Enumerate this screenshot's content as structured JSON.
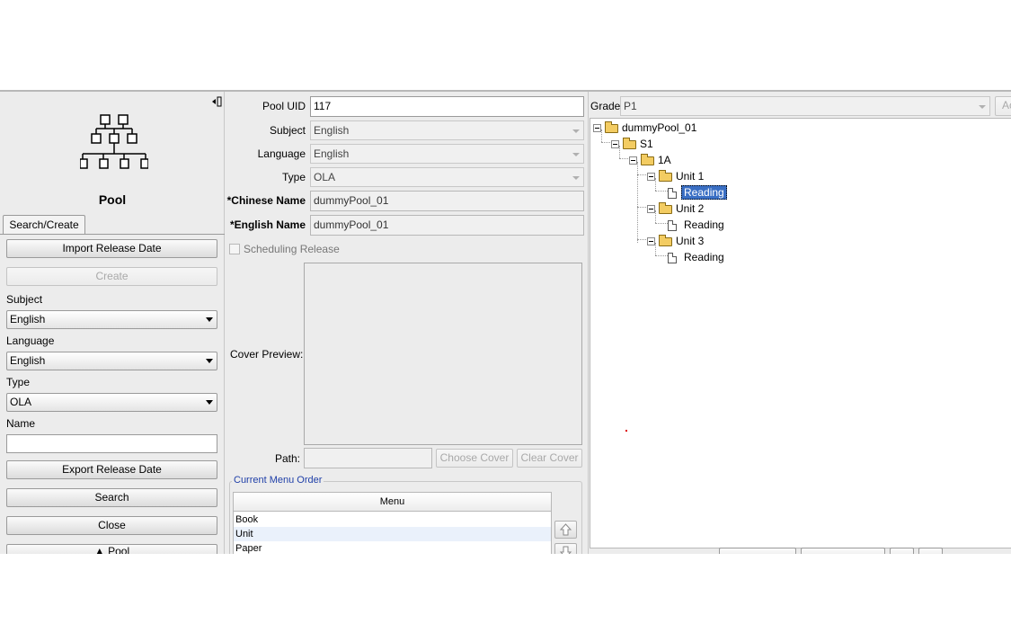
{
  "left_panel": {
    "icon_caption": "Pool",
    "tab": "Search/Create",
    "import_release_date": "Import Release Date",
    "create": "Create",
    "subject_label": "Subject",
    "subject_value": "English",
    "language_label": "Language",
    "language_value": "English",
    "type_label": "Type",
    "type_value": "OLA",
    "name_label": "Name",
    "name_value": "",
    "export_release_date": "Export Release Date",
    "search": "Search",
    "close": "Close",
    "bottom_toggle": "▲ Pool"
  },
  "form": {
    "pool_uid_label": "Pool UID",
    "pool_uid_value": "117",
    "subject_label": "Subject",
    "subject_value": "English",
    "language_label": "Language",
    "language_value": "English",
    "type_label": "Type",
    "type_value": "OLA",
    "chinese_name_label": "*Chinese Name",
    "chinese_name_value": "dummyPool_01",
    "english_name_label": "*English Name",
    "english_name_value": "dummyPool_01",
    "scheduling_release": "Scheduling Release",
    "cover_preview_label": "Cover Preview:",
    "path_label": "Path:",
    "path_value": "",
    "choose_cover": "Choose Cover",
    "clear_cover": "Clear Cover",
    "current_menu_order": "Current Menu Order",
    "menu_header": "Menu",
    "menu_rows": [
      "Book",
      "Unit",
      "Paper"
    ]
  },
  "right_panel": {
    "grade_label": "Grade",
    "grade_value": "P1",
    "add_button": "Ac",
    "tree": {
      "root": "dummyPool_01",
      "level1": "S1",
      "level2": "1A",
      "unit1": "Unit 1",
      "unit1_child": "Reading",
      "unit2": "Unit 2",
      "unit2_child": "Reading",
      "unit3": "Unit 3",
      "unit3_child": "Reading"
    }
  },
  "colors": {
    "selection": "#3a6fc4",
    "panel_bg": "#ececec",
    "group_title": "#1f3fa8"
  },
  "icons": [
    "hierarchy-icon",
    "collapse-panel-icon",
    "folder-icon",
    "file-icon",
    "move-up-icon",
    "move-down-icon",
    "chevron-down-icon"
  ]
}
